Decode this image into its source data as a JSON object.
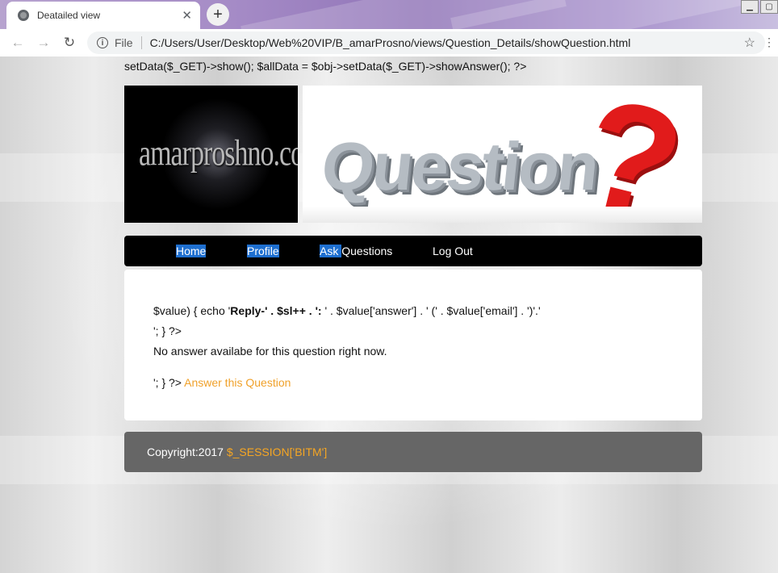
{
  "browser": {
    "tab_title": "Deatailed view",
    "url_scheme_label": "File",
    "url": "C:/Users/User/Desktop/Web%20VIP/B_amarProsno/views/Question_Details/showQuestion.html"
  },
  "page": {
    "php_line": "setData($_GET)->show(); $allData = $obj->setData($_GET)->showAnswer(); ?>",
    "banner": {
      "logo_text": "amarproshno.com",
      "graphic_word": "Question",
      "graphic_mark": "?"
    },
    "nav": {
      "home": "Home",
      "profile": "Profile",
      "ask_prefix": "Ask ",
      "ask_suffix": "Questions",
      "logout": "Log Out"
    },
    "content": {
      "line1_pre": "$value) { echo '",
      "line1_bold": "Reply-' . $sl++ . ':",
      "line1_post": " ' . $value['answer'] . ' (' . $value['email'] . ')'.'",
      "line2": "'; } ?>",
      "line3": "No answer availabe for this question right now.",
      "line4_pre": "'; } ?> ",
      "answer_link": "Answer this Question"
    },
    "footer": {
      "copyright": "Copyright:2017 ",
      "session": "$_SESSION['BITM']"
    }
  }
}
